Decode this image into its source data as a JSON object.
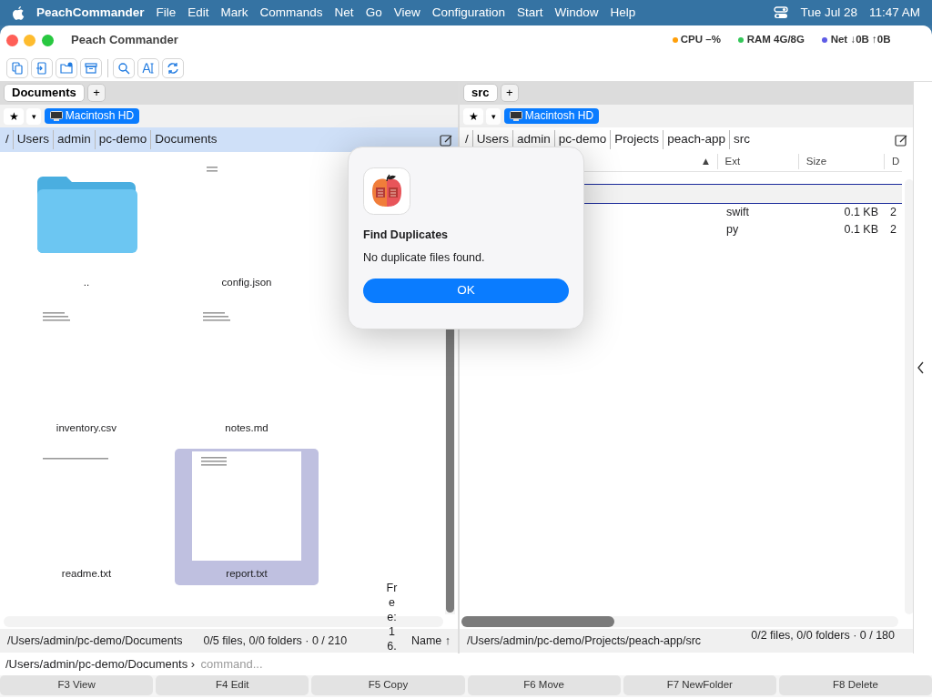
{
  "menu_bar": {
    "app_name": "PeachCommander",
    "items": [
      "File",
      "Edit",
      "Mark",
      "Commands",
      "Net",
      "Go",
      "View",
      "Configuration",
      "Start",
      "Window",
      "Help"
    ],
    "date": "Tue Jul 28",
    "time": "11:47 AM"
  },
  "window": {
    "title": "Peach Commander",
    "indicators": [
      {
        "label": "CPU –%",
        "color": "#ff9f0a"
      },
      {
        "label": "RAM 4G/8G",
        "color": "#34c759"
      },
      {
        "label": "Net ↓0B ↑0B",
        "color": "#5e5ce6"
      }
    ]
  },
  "left_panel": {
    "tabs": [
      {
        "label": "Documents",
        "selected": true
      }
    ],
    "add_tab": "+",
    "star": "★",
    "dropdown": "▾",
    "drive": "Macintosh HD",
    "active": true,
    "path": [
      "/",
      "Users",
      "admin",
      "pc-demo",
      "Documents"
    ],
    "files": [
      {
        "name": "..",
        "kind": "folder",
        "selected": false
      },
      {
        "name": "config.json",
        "kind": "document",
        "selected": false
      },
      {
        "name": "inventory.csv",
        "kind": "document",
        "selected": false
      },
      {
        "name": "notes.md",
        "kind": "document",
        "selected": false
      },
      {
        "name": "readme.txt",
        "kind": "document",
        "selected": false
      },
      {
        "name": "report.txt",
        "kind": "document",
        "selected": true
      }
    ],
    "free": "Free: 16.",
    "status_path": "/Users/admin/pc-demo/Documents",
    "status_counts": "0/5 files, 0/0 folders · 0 / 210",
    "sort": "Name ↑"
  },
  "right_panel": {
    "tabs": [
      {
        "label": "src",
        "selected": true
      }
    ],
    "add_tab": "+",
    "star": "★",
    "dropdown": "▾",
    "drive": "Macintosh HD",
    "active": false,
    "path": [
      "/",
      "Users",
      "admin",
      "pc-demo",
      "Projects",
      "peach-app",
      "src"
    ],
    "sort_arrow": "▲",
    "columns": [
      "Ext",
      "Size",
      "D"
    ],
    "rows": [
      {
        "focused": true
      },
      {
        "focused": false,
        "ext": "swift",
        "size": "0.1 KB",
        "column_4": "2"
      },
      {
        "focused": false,
        "ext": "py",
        "size": "0.1 KB",
        "column_4": "2"
      }
    ],
    "status_path": "/Users/admin/pc-demo/Projects/peach-app/src",
    "status_counts": "0/2 files, 0/0 folders · 0 / 180"
  },
  "dialog": {
    "title": "Find Duplicates",
    "message": "No duplicate files found.",
    "button": "OK"
  },
  "command_line": {
    "prompt": "/Users/admin/pc-demo/Documents ›",
    "placeholder": "command..."
  },
  "function_keys": [
    "F3 View",
    "F4 Edit",
    "F5 Copy",
    "F6 Move",
    "F7 NewFolder",
    "F8 Delete"
  ]
}
